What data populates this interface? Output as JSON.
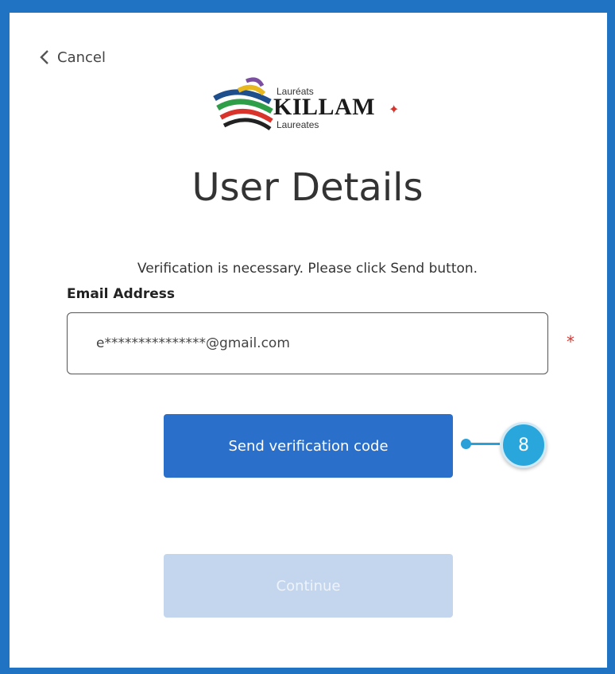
{
  "header": {
    "cancel_label": "Cancel"
  },
  "logo": {
    "top_text": "Lauréats",
    "main_text": "KILLAM",
    "bottom_text": "Laureates"
  },
  "page": {
    "title": "User Details",
    "intro": "Verification is necessary. Please click Send button."
  },
  "form": {
    "email_label": "Email Address",
    "email_value": "e***************@gmail.com",
    "required_mark": "*"
  },
  "buttons": {
    "send_label": "Send verification code",
    "continue_label": "Continue"
  },
  "callout": {
    "number": "8",
    "color": "#29a7dd"
  },
  "colors": {
    "frame": "#1f73c2",
    "primary": "#2a6fc9",
    "disabled": "#c4d6ee",
    "required": "#e0312b"
  }
}
